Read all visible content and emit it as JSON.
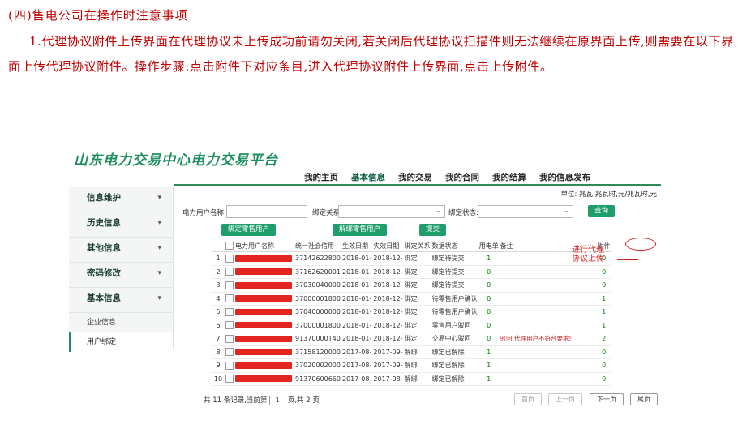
{
  "doc": {
    "heading": "(四)售电公司在操作时注意事项",
    "paragraph": "1.代理协议附件上传界面在代理协议未上传成功前请勿关闭,若关闭后代理协议扫描件则无法继续在原界面上传,则需要在以下界面上传代理协议附件。操作步骤:点击附件下对应条目,进入代理协议附件上传界面,点击上传附件。"
  },
  "app": {
    "title": "山东电力交易中心电力交易平台",
    "nav": [
      "我的主页",
      "基本信息",
      "我的交易",
      "我的合同",
      "我的结算",
      "我的信息发布"
    ],
    "nav_active": 1,
    "unit_text": "单位: 兆瓦,兆瓦时,元/兆瓦时,元"
  },
  "sidebar": {
    "items": [
      {
        "label": "信息维护",
        "chevron": "▾"
      },
      {
        "label": "历史信息",
        "chevron": "▾"
      },
      {
        "label": "其他信息",
        "chevron": "▾"
      },
      {
        "label": "密码修改",
        "chevron": "▾"
      },
      {
        "label": "基本信息",
        "chevron": "▾"
      }
    ],
    "subitems": [
      {
        "label": "企业信息"
      },
      {
        "label": "用户绑定"
      }
    ]
  },
  "filters": {
    "user_name_label": "电力用户名称:",
    "user_name_value": "",
    "bind_relation_label": "绑定关系:",
    "bind_relation_value": "",
    "bind_status_label": "绑定状态:",
    "bind_status_value": "",
    "dropdown_glyph": "⌄",
    "query_button": "查询"
  },
  "actions": {
    "bind_button": "绑定零售用户",
    "unbind_button": "解绑零售用户",
    "submit_button": "提交"
  },
  "table": {
    "columns": [
      "",
      "",
      "电力用户名称",
      "统一社会信用",
      "生效日期",
      "失效日期",
      "绑定关系",
      "数据状态",
      "用电单",
      "备注",
      "附件"
    ],
    "rows": [
      {
        "idx": "1",
        "code": "37142622800",
        "start": "2018-01-",
        "end": "2018-12-",
        "rel": "绑定",
        "status": "绑定待提交",
        "count": "1",
        "note": "",
        "att": "0"
      },
      {
        "idx": "2",
        "code": "37162620001",
        "start": "2018-01-",
        "end": "2018-12-",
        "rel": "绑定",
        "status": "绑定待提交",
        "count": "0",
        "note": "",
        "att": "0"
      },
      {
        "idx": "3",
        "code": "37030040000",
        "start": "2018-01-",
        "end": "2018-12-",
        "rel": "绑定",
        "status": "绑定待提交",
        "count": "0",
        "note": "",
        "att": "0"
      },
      {
        "idx": "4",
        "code": "37000001800",
        "start": "2018-01-",
        "end": "2018-12-",
        "rel": "绑定",
        "status": "待零售用户确认",
        "count": "0",
        "note": "",
        "att": "1"
      },
      {
        "idx": "5",
        "code": "37040000000",
        "start": "2018-01-",
        "end": "2018-12-",
        "rel": "绑定",
        "status": "待零售用户确认",
        "count": "0",
        "note": "",
        "att": "1"
      },
      {
        "idx": "6",
        "code": "37000001800",
        "start": "2018-01-",
        "end": "2018-12-",
        "rel": "绑定",
        "status": "零售用户驳回",
        "count": "0",
        "note": "",
        "att": "1"
      },
      {
        "idx": "7",
        "code": "91370000T40",
        "start": "2018-01-",
        "end": "2018-12-",
        "rel": "绑定",
        "status": "交易中心驳回",
        "count": "0",
        "note": "驳回,代理用户不符合要求!",
        "att": "2"
      },
      {
        "idx": "8",
        "code": "37158120000",
        "start": "2017-08-",
        "end": "2017-09-",
        "rel": "解绑",
        "status": "绑定已解除",
        "count": "1",
        "note": "",
        "att": "0"
      },
      {
        "idx": "9",
        "code": "37020002000",
        "start": "2017-08-",
        "end": "2017-09-",
        "rel": "解绑",
        "status": "绑定已解除",
        "count": "1",
        "note": "",
        "att": "0"
      },
      {
        "idx": "10",
        "code": "91370600660",
        "start": "2017-08-",
        "end": "2017-08-",
        "rel": "解绑",
        "status": "绑定已解除",
        "count": "1",
        "note": "",
        "att": "0"
      }
    ]
  },
  "annotation": {
    "line1": "进行代理",
    "line2": "协议上传"
  },
  "pagination": {
    "prefix": "共 11 条记录,当前第",
    "current_page": "1",
    "suffix": "页,共 2 页",
    "first": "首页",
    "prev": "上一页",
    "next": "下一页",
    "last": "尾页"
  }
}
